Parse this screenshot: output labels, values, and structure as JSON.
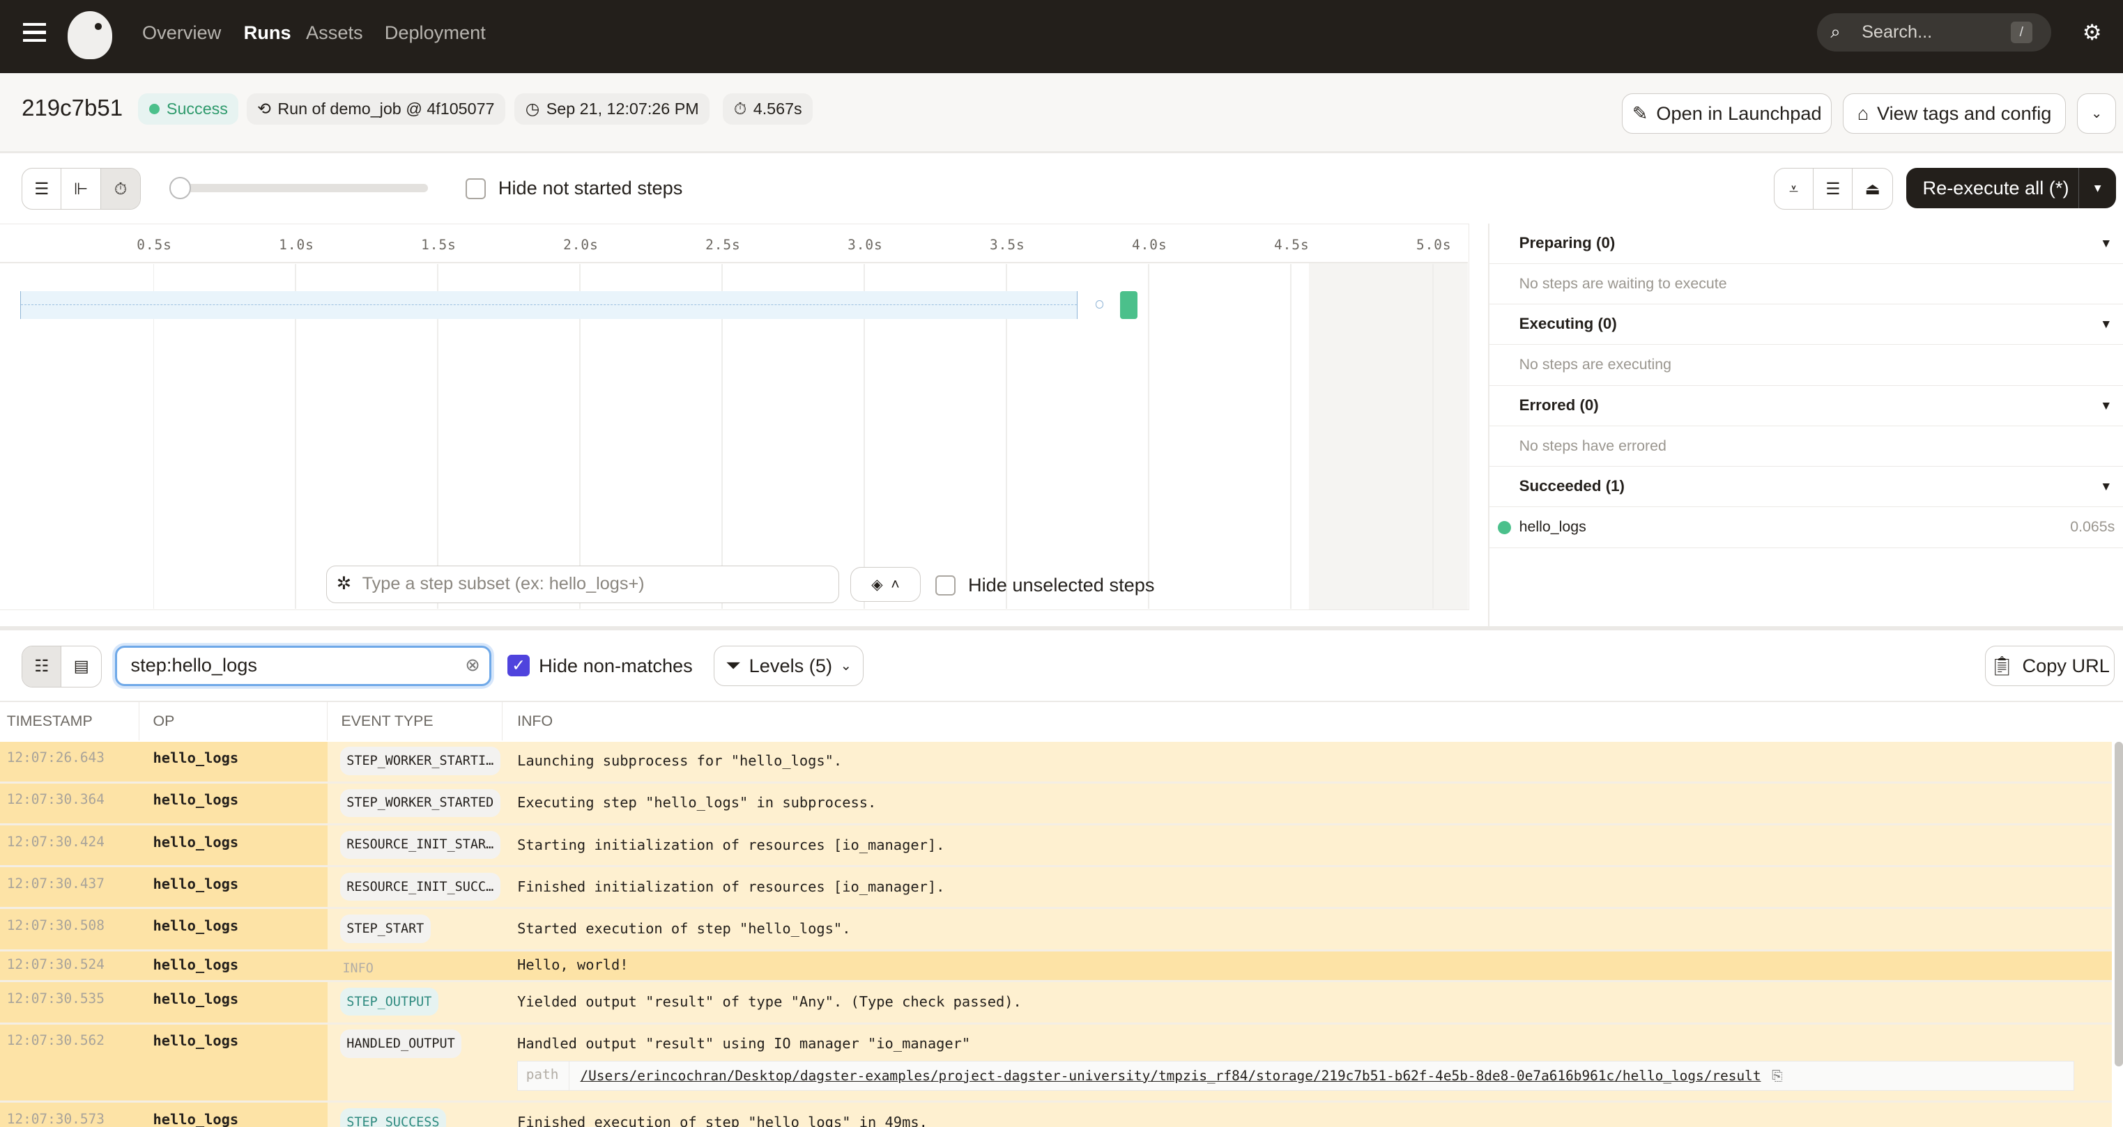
{
  "nav": {
    "items": [
      "Overview",
      "Runs",
      "Assets",
      "Deployment"
    ],
    "active": "Runs",
    "search_placeholder": "Search...",
    "search_shortcut": "/"
  },
  "run": {
    "id": "219c7b51",
    "status": "Success",
    "job": "Run of demo_job @ 4f105077",
    "started": "Sep 21, 12:07:26 PM",
    "duration": "4.567s"
  },
  "actions": {
    "launchpad": "Open in Launchpad",
    "tags": "View tags and config",
    "reexecute": "Re-execute all (*)"
  },
  "gantt": {
    "hide_not_started": "Hide not started steps",
    "ticks": [
      "0.5s",
      "1.0s",
      "1.5s",
      "2.0s",
      "2.5s",
      "3.0s",
      "3.5s",
      "4.0s",
      "4.5s",
      "5.0s"
    ],
    "subset_placeholder": "Type a step subset (ex: hello_logs+)",
    "hide_unselected": "Hide unselected steps",
    "zoom_level": 0
  },
  "status_panel": {
    "sections": [
      {
        "title": "Preparing (0)",
        "empty": "No steps are waiting to execute"
      },
      {
        "title": "Executing (0)",
        "empty": "No steps are executing"
      },
      {
        "title": "Errored (0)",
        "empty": "No steps have errored"
      },
      {
        "title": "Succeeded (1)",
        "steps": [
          {
            "name": "hello_logs",
            "duration": "0.065s"
          }
        ]
      }
    ]
  },
  "logs": {
    "filter_value": "step:hello_logs",
    "hide_non_matches": "Hide non-matches",
    "hide_non_matches_checked": true,
    "levels": "Levels (5)",
    "copy_url": "Copy URL",
    "columns": [
      "TIMESTAMP",
      "OP",
      "EVENT TYPE",
      "INFO"
    ],
    "rows": [
      {
        "ts": "12:07:26.643",
        "op": "hello_logs",
        "event": "STEP_WORKER_STARTI…",
        "style": "default",
        "info": "Launching subprocess for \"hello_logs\"."
      },
      {
        "ts": "12:07:30.364",
        "op": "hello_logs",
        "event": "STEP_WORKER_STARTED",
        "style": "default",
        "info": "Executing step \"hello_logs\" in subprocess."
      },
      {
        "ts": "12:07:30.424",
        "op": "hello_logs",
        "event": "RESOURCE_INIT_STAR…",
        "style": "default",
        "info": "Starting initialization of resources [io_manager]."
      },
      {
        "ts": "12:07:30.437",
        "op": "hello_logs",
        "event": "RESOURCE_INIT_SUCC…",
        "style": "default",
        "info": "Finished initialization of resources [io_manager]."
      },
      {
        "ts": "12:07:30.508",
        "op": "hello_logs",
        "event": "STEP_START",
        "style": "default",
        "info": "Started execution of step \"hello_logs\"."
      },
      {
        "ts": "12:07:30.524",
        "op": "hello_logs",
        "event": "INFO",
        "style": "info",
        "info": "Hello, world!"
      },
      {
        "ts": "12:07:30.535",
        "op": "hello_logs",
        "event": "STEP_OUTPUT",
        "style": "tint",
        "info": "Yielded output \"result\" of type \"Any\". (Type check passed)."
      },
      {
        "ts": "12:07:30.562",
        "op": "hello_logs",
        "event": "HANDLED_OUTPUT",
        "style": "default",
        "info": "Handled output \"result\" using IO manager \"io_manager\"",
        "path_key": "path",
        "path_value": "/Users/erincochran/Desktop/dagster-examples/project-dagster-university/tmpzis_rf84/storage/219c7b51-b62f-4e5b-8de8-0e7a616b961c/hello_logs/result"
      },
      {
        "ts": "12:07:30.573",
        "op": "hello_logs",
        "event": "STEP_SUCCESS",
        "style": "tint",
        "info": "Finished execution of step \"hello_logs\" in 49ms."
      }
    ]
  },
  "colors": {
    "topbar": "#231f1b",
    "success": "#4bc08b",
    "accent": "#4f43dd",
    "log_highlight": "#fde3a6"
  }
}
